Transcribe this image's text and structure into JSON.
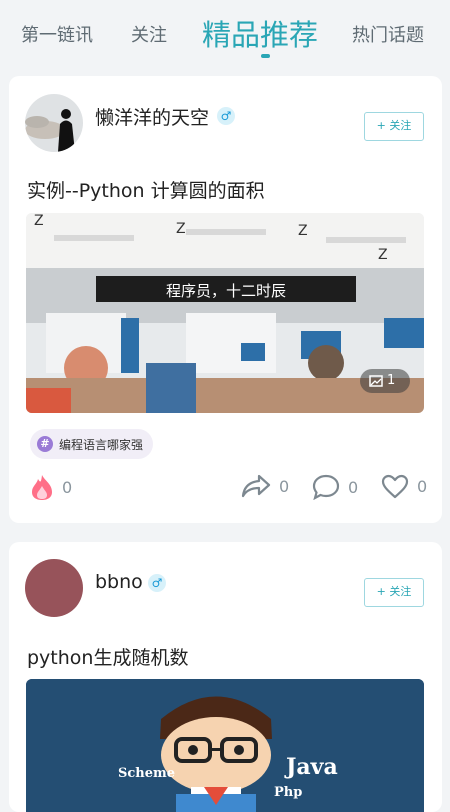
{
  "tabs": [
    "第一链讯",
    "关注",
    "精品推荐",
    "热门话题"
  ],
  "posts": [
    {
      "username": "懒洋洋的天空",
      "gender": "♂",
      "follow_label": "+ 关注",
      "title": "实例--Python 计算圆的面积",
      "image_caption": "程序员，十二时辰",
      "image_count": "1",
      "topic": "编程语言哪家强",
      "likes": "0",
      "shares": "0",
      "comments": "0",
      "favorites": "0"
    },
    {
      "username": "bbno",
      "gender": "♂",
      "follow_label": "+ 关注",
      "title": "python生成随机数",
      "image_words": [
        "Scheme",
        "Java",
        "Php"
      ]
    }
  ],
  "colors": {
    "accent": "#2aa6b5",
    "avatar2": "#97535a"
  }
}
